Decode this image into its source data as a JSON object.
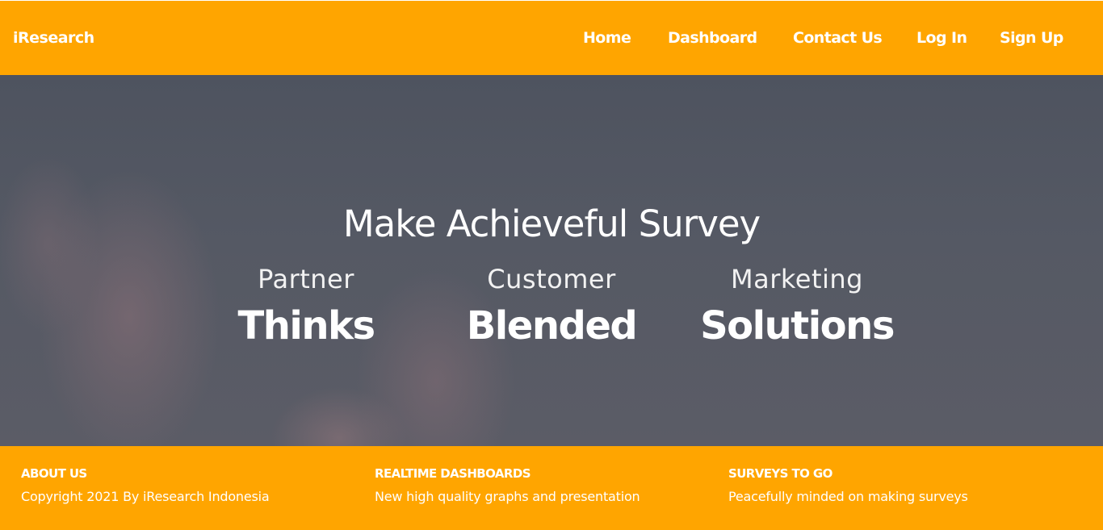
{
  "navbar": {
    "brand": "iResearch",
    "links": [
      "Home",
      "Dashboard",
      "Contact Us",
      "Log In",
      "Sign Up"
    ]
  },
  "hero": {
    "title": "Make Achieveful Survey",
    "features": [
      {
        "label": "Partner",
        "word": "Thinks"
      },
      {
        "label": "Customer",
        "word": "Blended"
      },
      {
        "label": "Marketing",
        "word": "Solutions"
      }
    ]
  },
  "footer": {
    "columns": [
      {
        "heading": "ABOUT US",
        "text": "Copyright 2021 By iResearch Indonesia"
      },
      {
        "heading": "REALTIME DASHBOARDS",
        "text": "New high quality graphs and presentation"
      },
      {
        "heading": "SURVEYS TO GO",
        "text": "Peacefully minded on making surveys"
      }
    ]
  },
  "colors": {
    "accent": "#ffa500",
    "hero_overlay": "#545862",
    "text": "#ffffff"
  }
}
